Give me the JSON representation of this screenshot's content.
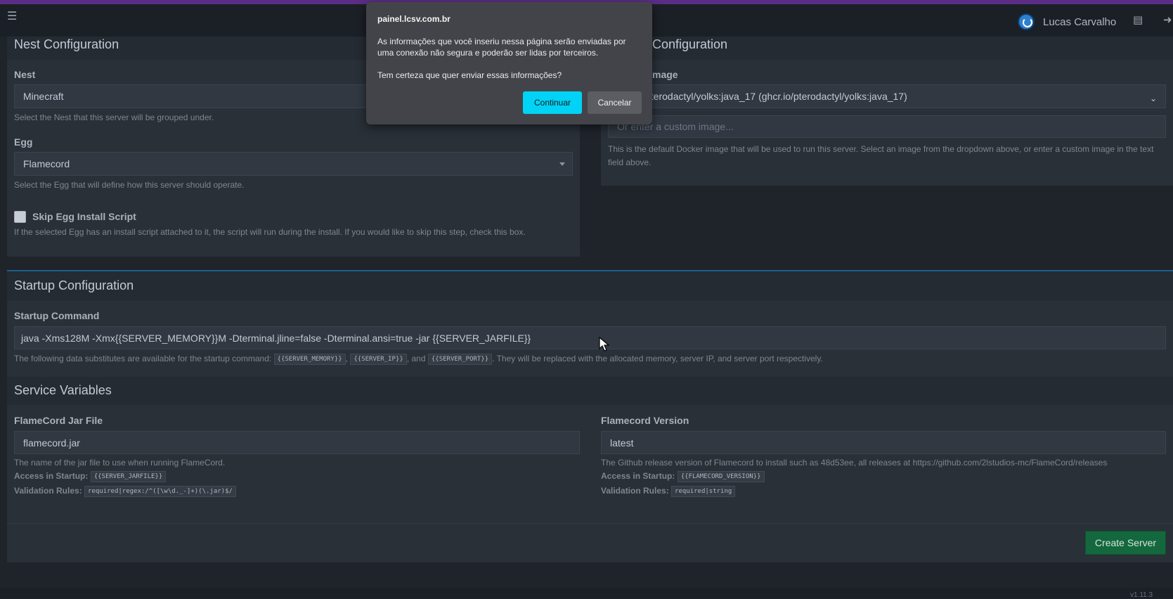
{
  "navbar": {
    "user_name": "Lucas Carvalho"
  },
  "nest_config": {
    "title": "Nest Configuration",
    "nest_label": "Nest",
    "nest_value": "Minecraft",
    "nest_help": "Select the Nest that this server will be grouped under.",
    "egg_label": "Egg",
    "egg_value": "Flamecord",
    "egg_help": "Select the Egg that will define how this server should operate.",
    "skip_label": "Skip Egg Install Script",
    "skip_help": "If the selected Egg has an install script attached to it, the script will run during the install. If you would like to skip this step, check this box."
  },
  "docker_config": {
    "title_partial": "Configuration",
    "image_label_partial": "mage",
    "image_value_partial": "pterodactyl/yolks:java_17 (ghcr.io/pterodactyl/yolks:java_17)",
    "custom_placeholder": "Or enter a custom image...",
    "help": "This is the default Docker image that will be used to run this server. Select an image from the dropdown above, or enter a custom image in the text field above."
  },
  "startup": {
    "title": "Startup Configuration",
    "command_label": "Startup Command",
    "command_value": "java -Xms128M -Xmx{{SERVER_MEMORY}}M -Dterminal.jline=false -Dterminal.ansi=true -jar {{SERVER_JARFILE}}",
    "help_prefix": "The following data substitutes are available for the startup command:",
    "code_memory": "{{SERVER_MEMORY}}",
    "sep1": ",",
    "code_ip": "{{SERVER_IP}}",
    "sep2": ", and",
    "code_port": "{{SERVER_PORT}}",
    "help_suffix": ". They will be replaced with the allocated memory, server IP, and server port respectively."
  },
  "service_vars": {
    "title": "Service Variables",
    "var1": {
      "label": "FlameCord Jar File",
      "value": "flamecord.jar",
      "help": "The name of the jar file to use when running FlameCord.",
      "access_label": "Access in Startup:",
      "access_code": "{{SERVER_JARFILE}}",
      "rules_label": "Validation Rules:",
      "rules_code": "required|regex:/^([\\w\\d._-]+)(\\.jar)$/"
    },
    "var2": {
      "label": "Flamecord Version",
      "value": "latest",
      "help": "The Github release version of Flamecord to install such as 48d53ee, all releases at https://github.com/2lstudios-mc/FlameCord/releases",
      "access_label": "Access in Startup:",
      "access_code": "{{FLAMECORD_VERSION}}",
      "rules_label": "Validation Rules:",
      "rules_code": "required|string"
    }
  },
  "create_button": "Create Server",
  "footer_version": "v1.11.3",
  "dialog": {
    "host": "painel.lcsv.com.br",
    "message": "As informações que você inseriu nessa página serão enviadas por uma conexão não segura e poderão ser lidas por terceiros.",
    "question": "Tem certeza que quer enviar essas informações?",
    "continue_label": "Continuar",
    "cancel_label": "Cancelar"
  },
  "colors": {
    "accent_top": "#5b2d86",
    "create_button": "#14683d",
    "dialog_primary": "#00d3f5"
  }
}
